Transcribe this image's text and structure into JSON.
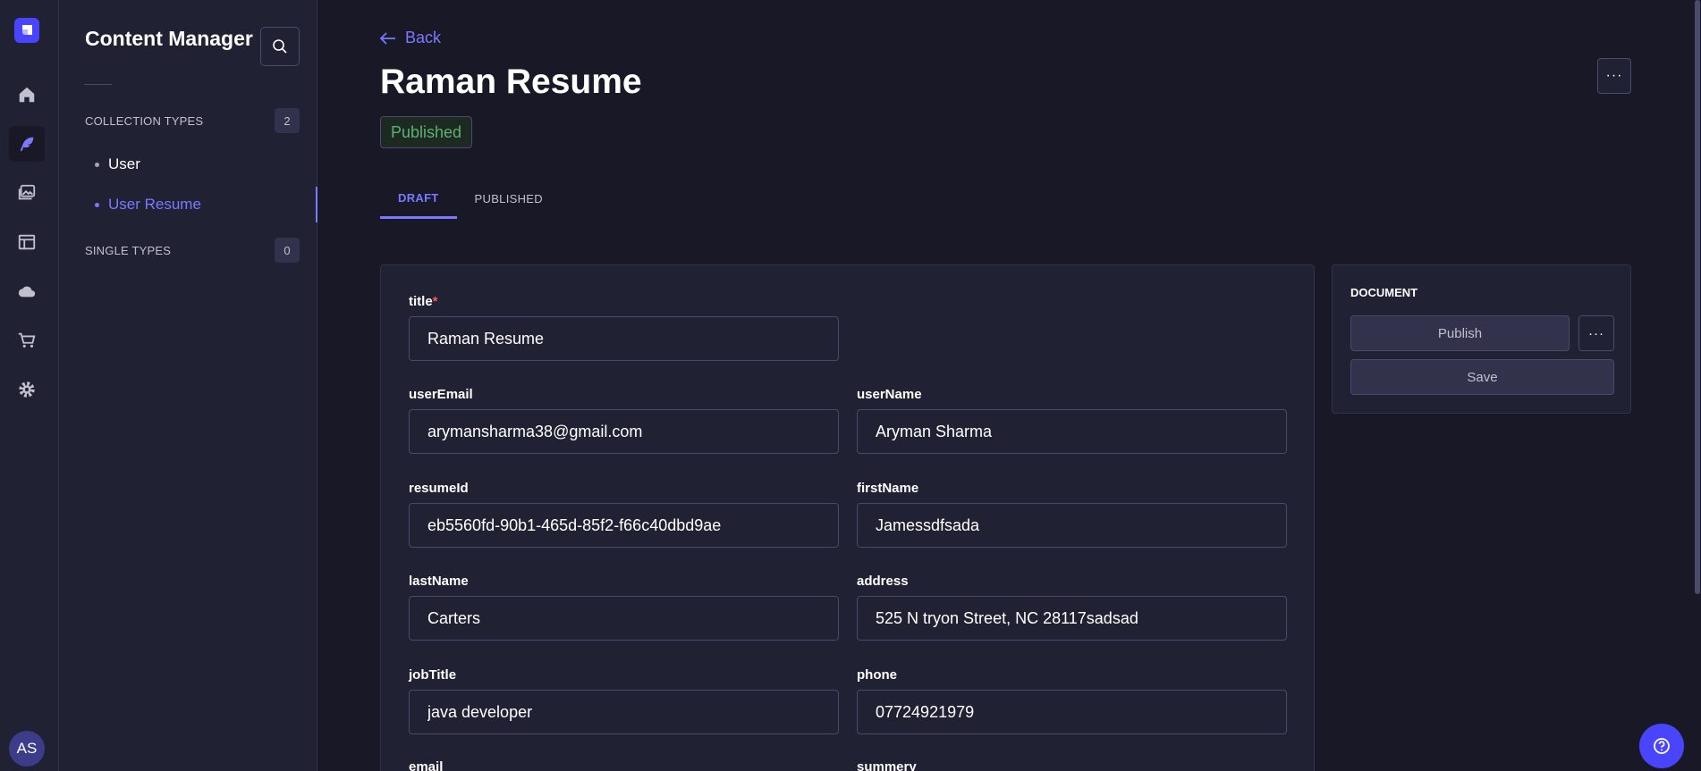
{
  "rail": {
    "items": [
      {
        "icon": "home-icon"
      },
      {
        "icon": "feather-icon",
        "active": true
      },
      {
        "icon": "images-icon"
      },
      {
        "icon": "layout-icon"
      },
      {
        "icon": "cloud-icon"
      },
      {
        "icon": "cart-icon"
      },
      {
        "icon": "gear-icon"
      }
    ],
    "avatar_initials": "AS"
  },
  "subnav": {
    "title": "Content Manager",
    "collection_types": {
      "label": "COLLECTION TYPES",
      "count": "2",
      "items": [
        {
          "label": "User"
        },
        {
          "label": "User Resume",
          "active": true
        }
      ]
    },
    "single_types": {
      "label": "SINGLE TYPES",
      "count": "0"
    }
  },
  "header": {
    "back_label": "Back",
    "title": "Raman Resume",
    "status": "Published"
  },
  "tabs": [
    {
      "label": "DRAFT",
      "active": true
    },
    {
      "label": "PUBLISHED"
    }
  ],
  "form": {
    "title": {
      "label": "title",
      "required_mark": "*",
      "value": "Raman Resume"
    },
    "userEmail": {
      "label": "userEmail",
      "value": "arymansharma38@gmail.com"
    },
    "userName": {
      "label": "userName",
      "value": "Aryman Sharma"
    },
    "resumeId": {
      "label": "resumeId",
      "value": "eb5560fd-90b1-465d-85f2-f66c40dbd9ae"
    },
    "firstName": {
      "label": "firstName",
      "value": "Jamessdfsada"
    },
    "lastName": {
      "label": "lastName",
      "value": "Carters"
    },
    "address": {
      "label": "address",
      "value": "525 N tryon Street, NC 28117sadsad"
    },
    "jobTitle": {
      "label": "jobTitle",
      "value": "java developer"
    },
    "phone": {
      "label": "phone",
      "value": "07724921979"
    },
    "email": {
      "label": "email"
    },
    "summery": {
      "label": "summery"
    }
  },
  "document_panel": {
    "label": "DOCUMENT",
    "publish_label": "Publish",
    "more_label": "···",
    "save_label": "Save"
  },
  "more_top_label": "···",
  "colors": {
    "accent": "#7b79ff",
    "primary": "#4945ff",
    "published_green": "#5cb176",
    "required_red": "#ee5e52",
    "background": "#181826",
    "panel": "#212134"
  }
}
